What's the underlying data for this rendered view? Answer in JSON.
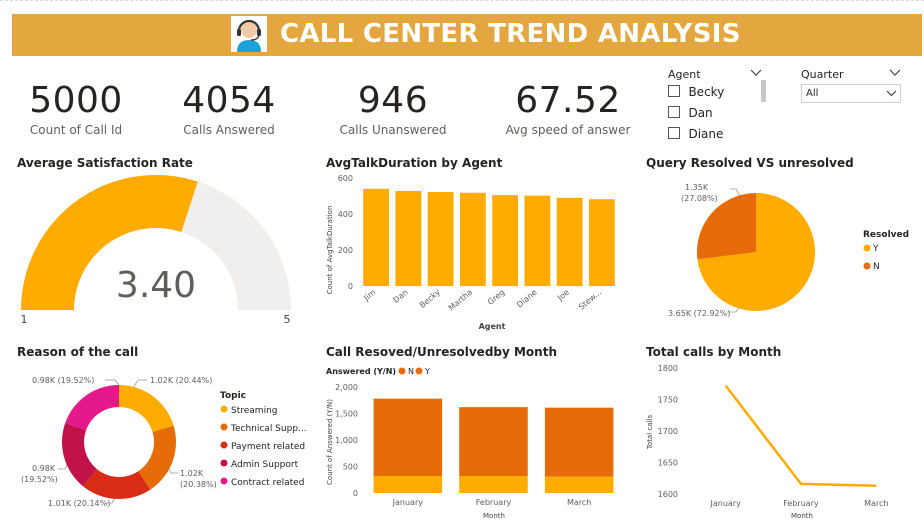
{
  "header": {
    "title": "CALL CENTER TREND ANALYSIS"
  },
  "kpis": [
    {
      "value": "5000",
      "label": "Count of Call Id"
    },
    {
      "value": "4054",
      "label": "Calls Answered"
    },
    {
      "value": "946",
      "label": "Calls Unanswered"
    },
    {
      "value": "67.52",
      "label": "Avg speed of answer"
    }
  ],
  "slicers": {
    "agent": {
      "title": "Agent",
      "items": [
        "Becky",
        "Dan",
        "Diane"
      ]
    },
    "quarter": {
      "title": "Quarter",
      "selected": "All"
    }
  },
  "colors": {
    "accent": "#e4a73f",
    "yellow": "#FFAB00",
    "orange": "#E66C0A",
    "red": "#D82C16",
    "crimson": "#C1124A",
    "pink": "#E6198C",
    "gray": "#F0EFEE"
  },
  "icons": [
    "operator-headset-icon",
    "chevron-down-icon"
  ],
  "gauge": {
    "title": "Average Satisfaction Rate",
    "value_label": "3.40",
    "min_label": "1",
    "max_label": "5",
    "chart_data": {
      "type": "gauge",
      "value": 3.4,
      "min": 1,
      "max": 5
    }
  },
  "talk": {
    "title": "AvgTalkDuration by Agent",
    "xlabel": "Agent",
    "ylabel": "Count of AvgTalkDuration",
    "chart_data": {
      "type": "bar",
      "categories": [
        "Jim",
        "Dan",
        "Becky",
        "Martha",
        "Greg",
        "Diane",
        "Joe",
        "Stew..."
      ],
      "values": [
        540,
        528,
        522,
        518,
        505,
        502,
        490,
        482
      ],
      "ylim": [
        0,
        600
      ],
      "yticks": [
        "0",
        "200",
        "400",
        "600"
      ]
    }
  },
  "resolved": {
    "title": "Query Resolved VS unresolved",
    "legend_title": "Resolved",
    "chart_data": {
      "type": "pie",
      "slices": [
        {
          "name": "Y",
          "value": 3650,
          "label": "3.65K (72.92%)"
        },
        {
          "name": "N",
          "value": 1350,
          "label1": "1.35K",
          "label2": "(27.08%)"
        }
      ]
    }
  },
  "reason": {
    "title": "Reason of the call",
    "legend_title": "Topic",
    "chart_data": {
      "type": "pie",
      "slices": [
        {
          "name": "Streaming",
          "value": 1020,
          "label": "1.02K (20.44%)"
        },
        {
          "name": "Technical Supp...",
          "value": 1020,
          "label1": "1.02K",
          "label2": "(20.38%)"
        },
        {
          "name": "Payment related",
          "value": 1010,
          "label": "1.01K (20.14%)"
        },
        {
          "name": "Admin Support",
          "value": 980,
          "label1": "0.98K",
          "label2": "(19.52%)"
        },
        {
          "name": "Contract related",
          "value": 980,
          "label": "0.98K (19.52%)"
        }
      ]
    }
  },
  "monthly": {
    "title": "Call Resoved/Unresolvedby Month",
    "legend_title": "Answered (Y/N)",
    "xlabel": "Month",
    "ylabel": "Count of Answered (Y/N)",
    "chart_data": {
      "type": "bar",
      "stacked": true,
      "categories": [
        "January",
        "February",
        "March"
      ],
      "series": [
        {
          "name": "N",
          "values": [
            320,
            320,
            310
          ]
        },
        {
          "name": "Y",
          "values": [
            1460,
            1300,
            1300
          ]
        }
      ],
      "ylim": [
        0,
        2000
      ],
      "yticks": [
        "0",
        "500",
        "1,000",
        "1,500",
        "2,000"
      ]
    }
  },
  "total": {
    "title": "Total calls by Month",
    "xlabel": "Month",
    "ylabel": "Total calls",
    "chart_data": {
      "type": "line",
      "x": [
        "January",
        "February",
        "March"
      ],
      "values": [
        1772,
        1616,
        1613
      ],
      "ylim": [
        1600,
        1800
      ],
      "yticks": [
        "1600",
        "1650",
        "1700",
        "1750",
        "1800"
      ]
    }
  }
}
